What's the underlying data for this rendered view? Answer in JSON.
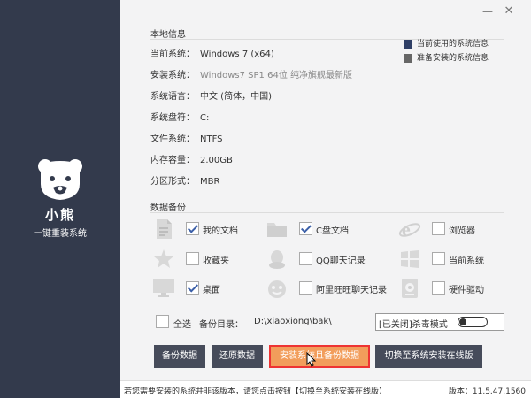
{
  "brand": {
    "name": "小熊",
    "subtitle": "一键重装系统"
  },
  "window": {
    "minimize_glyph": "—",
    "close_glyph": "✕"
  },
  "local_info": {
    "title": "本地信息",
    "rows": [
      {
        "label": "当前系统：",
        "value": "Windows 7 (x64)"
      },
      {
        "label": "安装系统：",
        "value": "Windows7 SP1 64位 纯净旗舰最新版"
      },
      {
        "label": "系统语言：",
        "value": "中文 (简体，中国)"
      },
      {
        "label": "系统盘符：",
        "value": "C:"
      },
      {
        "label": "文件系统：",
        "value": "NTFS"
      },
      {
        "label": "内存容量：",
        "value": "2.00GB"
      },
      {
        "label": "分区形式：",
        "value": "MBR"
      }
    ]
  },
  "legend": [
    {
      "label": "当前使用的系统信息",
      "color": "#2f3f66"
    },
    {
      "label": "准备安装的系统信息",
      "color": "#666666"
    }
  ],
  "backup": {
    "title": "数据备份",
    "items": [
      {
        "label": "我的文档",
        "checked": true,
        "icon": "document-icon"
      },
      {
        "label": "C盘文档",
        "checked": true,
        "icon": "folder-icon"
      },
      {
        "label": "浏览器",
        "checked": false,
        "icon": "ie-browser-icon"
      },
      {
        "label": "收藏夹",
        "checked": false,
        "icon": "star-icon"
      },
      {
        "label": "QQ聊天记录",
        "checked": false,
        "icon": "qq-icon"
      },
      {
        "label": "当前系统",
        "checked": false,
        "icon": "windows-icon"
      },
      {
        "label": "桌面",
        "checked": true,
        "icon": "monitor-icon"
      },
      {
        "label": "阿里旺旺聊天记录",
        "checked": false,
        "icon": "wangwang-icon"
      },
      {
        "label": "硬件驱动",
        "checked": false,
        "icon": "hardware-driver-icon"
      }
    ],
    "select_all": {
      "label": "全选",
      "checked": false
    },
    "dir_label": "备份目录：",
    "dir_path": "D:\\xiaoxiong\\bak\\",
    "antivirus": {
      "label": "[已关闭]杀毒模式",
      "on": false
    }
  },
  "buttons": {
    "backup": "备份数据",
    "restore": "还原数据",
    "install_backup": "安装系统且备份数据",
    "switch_online": "切换至系统安装在线版"
  },
  "status": {
    "message": "若您需要安装的系统并非该版本，请您点击按钮【切换至系统安装在线版】",
    "version": "版本：11.5.47.1560"
  },
  "colors": {
    "sidebar": "#333a4c",
    "accent": "#3b5fa8",
    "orange": "#f29d5b",
    "button_dark": "#464b5a"
  }
}
